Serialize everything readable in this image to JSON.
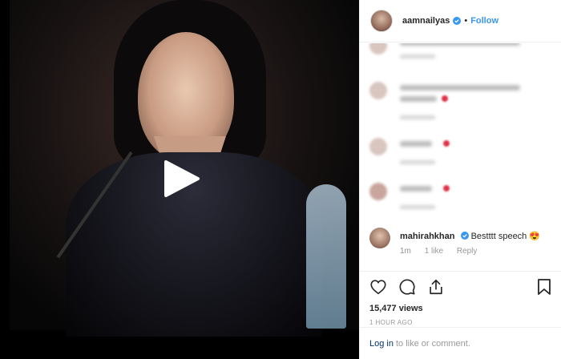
{
  "header": {
    "username": "aamnailyas",
    "separator": "•",
    "follow_label": "Follow"
  },
  "comments": [
    {
      "username": "mahirahkhan",
      "text": "Bestttt speech 😍",
      "age": "1m",
      "likes": "1 like",
      "reply": "Reply"
    }
  ],
  "stats": {
    "views": "15,477 views",
    "time_ago": "1 HOUR AGO"
  },
  "login": {
    "link_label": "Log in",
    "rest_text": "to like or comment."
  },
  "icons": {
    "like": "heart-icon",
    "comment": "comment-icon",
    "share": "share-icon",
    "save": "bookmark-icon",
    "play": "play-icon",
    "verified": "verified-badge-icon"
  },
  "colors": {
    "accent": "#3897f0",
    "verified": "#3897f0",
    "link": "#003569",
    "muted": "#999999",
    "border": "#efefef"
  }
}
